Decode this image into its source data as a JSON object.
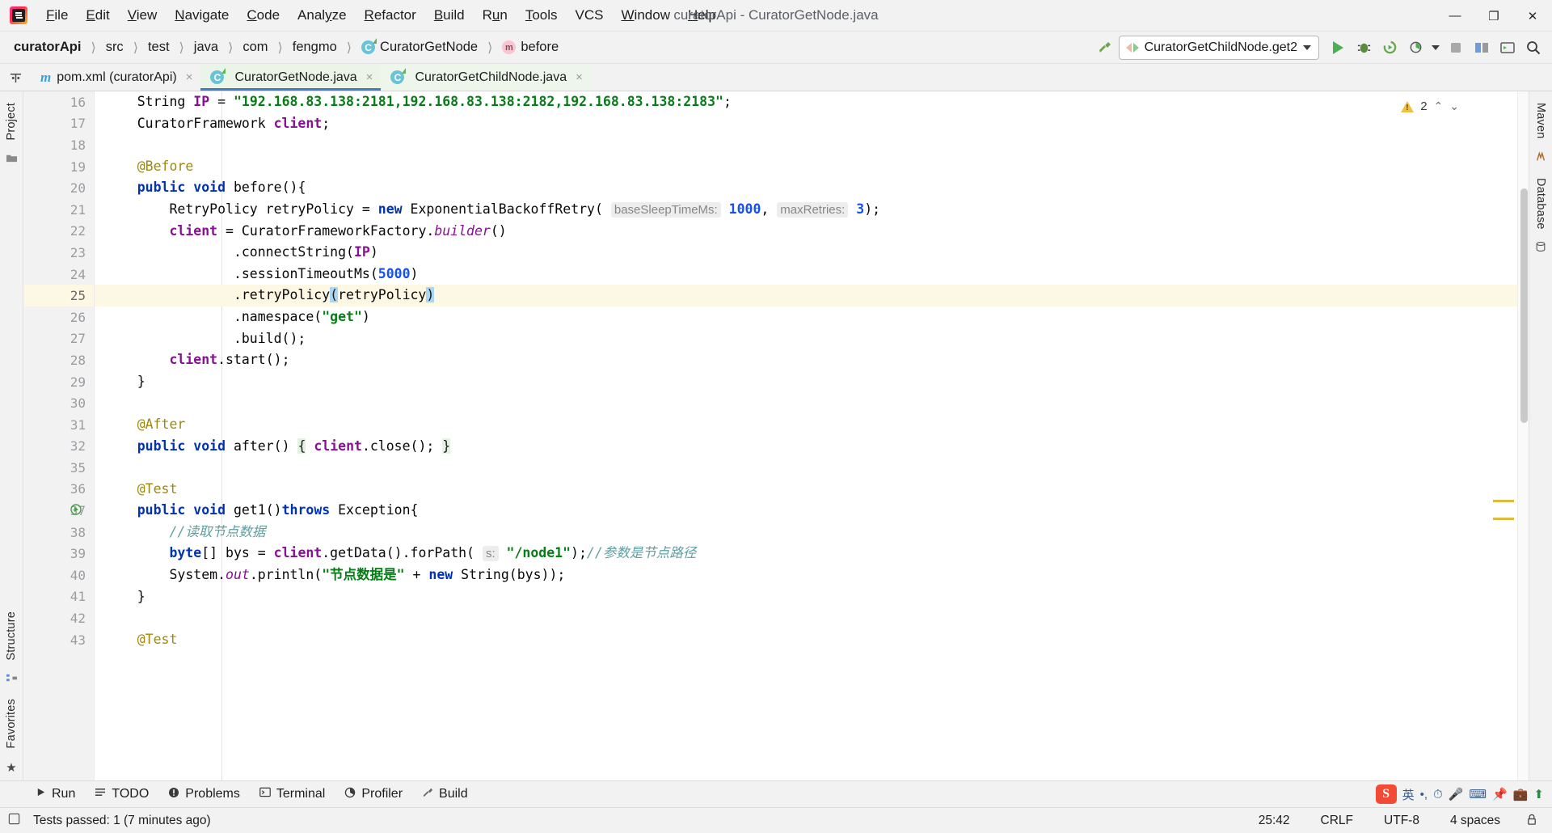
{
  "window": {
    "title": "curatorApi - CuratorGetNode.java",
    "logo_icon": "intellij-idea-logo",
    "minimize_label": "—",
    "maximize_label": "❐",
    "close_label": "✕"
  },
  "menu": [
    {
      "label": "File",
      "mnemonic": "F"
    },
    {
      "label": "Edit",
      "mnemonic": "E"
    },
    {
      "label": "View",
      "mnemonic": "V"
    },
    {
      "label": "Navigate",
      "mnemonic": "N"
    },
    {
      "label": "Code",
      "mnemonic": "C"
    },
    {
      "label": "Analyze",
      "mnemonic": "y"
    },
    {
      "label": "Refactor",
      "mnemonic": "R"
    },
    {
      "label": "Build",
      "mnemonic": "B"
    },
    {
      "label": "Run",
      "mnemonic": "u"
    },
    {
      "label": "Tools",
      "mnemonic": "T"
    },
    {
      "label": "VCS",
      "mnemonic": ""
    },
    {
      "label": "Window",
      "mnemonic": "W"
    },
    {
      "label": "Help",
      "mnemonic": "H"
    }
  ],
  "breadcrumb": [
    {
      "label": "curatorApi",
      "icon": "",
      "bold": true
    },
    {
      "label": "src",
      "icon": "",
      "bold": false
    },
    {
      "label": "test",
      "icon": "",
      "bold": false
    },
    {
      "label": "java",
      "icon": "",
      "bold": false
    },
    {
      "label": "com",
      "icon": "",
      "bold": false
    },
    {
      "label": "fengmo",
      "icon": "",
      "bold": false
    },
    {
      "label": "CuratorGetNode",
      "icon": "class-icon",
      "bold": false
    },
    {
      "label": "before",
      "icon": "method-icon",
      "bold": false
    }
  ],
  "navbar_right": {
    "build_icon": "hammer-icon",
    "run_config": "CuratorGetChildNode.get2",
    "run_config_icon": "run-config-icon",
    "dropdown_icon": "chevron-down-icon",
    "buttons": [
      {
        "name": "run-button",
        "glyph": "▶"
      },
      {
        "name": "debug-button",
        "glyph": "🐞"
      },
      {
        "name": "run-with-coverage-button",
        "glyph": "▶"
      },
      {
        "name": "profile-button",
        "glyph": "◴"
      },
      {
        "name": "profile-dropdown-icon",
        "glyph": "▾"
      },
      {
        "name": "stop-button",
        "glyph": "■"
      },
      {
        "name": "update-project-button",
        "glyph": "☰"
      },
      {
        "name": "open-in-browser-button",
        "glyph": "⬚"
      },
      {
        "name": "search-everywhere-button",
        "glyph": "🔍"
      }
    ]
  },
  "tabs": [
    {
      "label": "pom.xml (curatorApi)",
      "icon": "xml-file-icon",
      "active": false,
      "close": "×"
    },
    {
      "label": "CuratorGetNode.java",
      "icon": "java-class-icon",
      "active": true,
      "close": "×"
    },
    {
      "label": "CuratorGetChildNode.java",
      "icon": "java-class-icon",
      "active": false,
      "close": "×"
    }
  ],
  "left_stripe": [
    {
      "label": "Project",
      "name": "tool-window-project"
    },
    {
      "label": "Structure",
      "name": "tool-window-structure"
    },
    {
      "label": "Favorites",
      "name": "tool-window-favorites"
    }
  ],
  "right_stripe": [
    {
      "label": "Maven",
      "name": "tool-window-maven"
    },
    {
      "label": "Database",
      "name": "tool-window-database"
    }
  ],
  "editor": {
    "inspection_warnings": "2",
    "warning_icon": "warning-triangle-icon",
    "prev_icon": "⌃",
    "next_icon": "⌄",
    "lines": [
      {
        "n": "16",
        "tokens": [
          {
            "t": "    String ",
            "c": "plain"
          },
          {
            "t": "IP ",
            "c": "fld"
          },
          {
            "t": "= ",
            "c": "plain"
          },
          {
            "t": "\"192.168.83.138:2181,192.168.83.138:2182,192.168.83.138:2183\"",
            "c": "str"
          },
          {
            "t": ";",
            "c": "plain"
          }
        ]
      },
      {
        "n": "17",
        "tokens": [
          {
            "t": "    CuratorFramework ",
            "c": "plain"
          },
          {
            "t": "client",
            "c": "fld"
          },
          {
            "t": ";",
            "c": "plain"
          }
        ]
      },
      {
        "n": "18",
        "tokens": []
      },
      {
        "n": "19",
        "tokens": [
          {
            "t": "    @Before",
            "c": "ann"
          }
        ]
      },
      {
        "n": "20",
        "fold": true,
        "tokens": [
          {
            "t": "    ",
            "c": "plain"
          },
          {
            "t": "public void ",
            "c": "kw"
          },
          {
            "t": "before(){",
            "c": "plain"
          }
        ]
      },
      {
        "n": "21",
        "tokens": [
          {
            "t": "        RetryPolicy retryPolicy = ",
            "c": "plain"
          },
          {
            "t": "new ",
            "c": "kw"
          },
          {
            "t": "ExponentialBackoffRetry( ",
            "c": "plain"
          },
          {
            "t": "baseSleepTimeMs:",
            "c": "hint"
          },
          {
            "t": " ",
            "c": "plain"
          },
          {
            "t": "1000",
            "c": "num"
          },
          {
            "t": ", ",
            "c": "plain"
          },
          {
            "t": "maxRetries:",
            "c": "hint"
          },
          {
            "t": " ",
            "c": "plain"
          },
          {
            "t": "3",
            "c": "num"
          },
          {
            "t": ");",
            "c": "plain"
          }
        ]
      },
      {
        "n": "22",
        "tokens": [
          {
            "t": "        ",
            "c": "plain"
          },
          {
            "t": "client ",
            "c": "fld"
          },
          {
            "t": "= CuratorFrameworkFactory.",
            "c": "plain"
          },
          {
            "t": "builder",
            "c": "stat"
          },
          {
            "t": "()",
            "c": "plain"
          }
        ]
      },
      {
        "n": "23",
        "tokens": [
          {
            "t": "                .connectString(",
            "c": "plain"
          },
          {
            "t": "IP",
            "c": "fld"
          },
          {
            "t": ")",
            "c": "plain"
          }
        ]
      },
      {
        "n": "24",
        "tokens": [
          {
            "t": "                .sessionTimeoutMs(",
            "c": "plain"
          },
          {
            "t": "5000",
            "c": "num"
          },
          {
            "t": ")",
            "c": "plain"
          }
        ]
      },
      {
        "n": "25",
        "cur": true,
        "tokens": [
          {
            "t": "                .retryPolicy",
            "c": "plain"
          },
          {
            "t": "(",
            "c": "brkt-hl"
          },
          {
            "t": "retryPolicy",
            "c": "plain"
          },
          {
            "t": ")",
            "c": "brkt-hl"
          }
        ]
      },
      {
        "n": "26",
        "tokens": [
          {
            "t": "                .namespace(",
            "c": "plain"
          },
          {
            "t": "\"get\"",
            "c": "str"
          },
          {
            "t": ")",
            "c": "plain"
          }
        ]
      },
      {
        "n": "27",
        "tokens": [
          {
            "t": "                .build();",
            "c": "plain"
          }
        ]
      },
      {
        "n": "28",
        "tokens": [
          {
            "t": "        ",
            "c": "plain"
          },
          {
            "t": "client",
            "c": "fld"
          },
          {
            "t": ".start();",
            "c": "plain"
          }
        ]
      },
      {
        "n": "29",
        "fold": true,
        "tokens": [
          {
            "t": "    }",
            "c": "plain"
          }
        ]
      },
      {
        "n": "30",
        "tokens": []
      },
      {
        "n": "31",
        "tokens": [
          {
            "t": "    @After",
            "c": "ann"
          }
        ]
      },
      {
        "n": "32",
        "fold": true,
        "tokens": [
          {
            "t": "    ",
            "c": "plain"
          },
          {
            "t": "public void ",
            "c": "kw"
          },
          {
            "t": "after() ",
            "c": "plain"
          },
          {
            "t": "{",
            "c": "brace-hl"
          },
          {
            "t": " ",
            "c": "plain"
          },
          {
            "t": "client",
            "c": "fld"
          },
          {
            "t": ".close(); ",
            "c": "plain"
          },
          {
            "t": "}",
            "c": "brace-hl"
          }
        ]
      },
      {
        "n": "35",
        "tokens": []
      },
      {
        "n": "36",
        "tokens": [
          {
            "t": "    @Test",
            "c": "ann"
          }
        ]
      },
      {
        "n": "37",
        "fold": true,
        "runmark": true,
        "tokens": [
          {
            "t": "    ",
            "c": "plain"
          },
          {
            "t": "public void ",
            "c": "kw"
          },
          {
            "t": "get1()",
            "c": "plain"
          },
          {
            "t": "throws ",
            "c": "kw"
          },
          {
            "t": "Exception{",
            "c": "plain"
          }
        ]
      },
      {
        "n": "38",
        "tokens": [
          {
            "t": "        //读取节点数据",
            "c": "cmt-zh"
          }
        ]
      },
      {
        "n": "39",
        "tokens": [
          {
            "t": "        ",
            "c": "plain"
          },
          {
            "t": "byte",
            "c": "kw"
          },
          {
            "t": "[] bys = ",
            "c": "plain"
          },
          {
            "t": "client",
            "c": "fld"
          },
          {
            "t": ".getData().forPath( ",
            "c": "plain"
          },
          {
            "t": "s:",
            "c": "hint"
          },
          {
            "t": " ",
            "c": "plain"
          },
          {
            "t": "\"/node1\"",
            "c": "str"
          },
          {
            "t": ");",
            "c": "plain"
          },
          {
            "t": "//参数是节点路径",
            "c": "cmt-zh"
          }
        ]
      },
      {
        "n": "40",
        "tokens": [
          {
            "t": "        System.",
            "c": "plain"
          },
          {
            "t": "out",
            "c": "stat"
          },
          {
            "t": ".println(",
            "c": "plain"
          },
          {
            "t": "\"节点数据是\"",
            "c": "str"
          },
          {
            "t": " + ",
            "c": "plain"
          },
          {
            "t": "new ",
            "c": "kw"
          },
          {
            "t": "String(bys));",
            "c": "plain"
          }
        ]
      },
      {
        "n": "41",
        "fold": true,
        "tokens": [
          {
            "t": "    }",
            "c": "plain"
          }
        ]
      },
      {
        "n": "42",
        "tokens": []
      },
      {
        "n": "43",
        "tokens": [
          {
            "t": "    @Test",
            "c": "ann"
          }
        ]
      }
    ]
  },
  "bottom_toolwindows": [
    {
      "label": "Run",
      "icon": "run-icon",
      "name": "tool-window-run"
    },
    {
      "label": "TODO",
      "icon": "todo-icon",
      "name": "tool-window-todo"
    },
    {
      "label": "Problems",
      "icon": "problems-icon",
      "name": "tool-window-problems"
    },
    {
      "label": "Terminal",
      "icon": "terminal-icon",
      "name": "tool-window-terminal"
    },
    {
      "label": "Profiler",
      "icon": "profiler-icon",
      "name": "tool-window-profiler"
    },
    {
      "label": "Build",
      "icon": "build-icon",
      "name": "tool-window-build"
    }
  ],
  "tray": {
    "ime_label": "英",
    "items": [
      "sogou-icon",
      "ime-mode",
      "dot-menu",
      "clock-icon",
      "mic-icon",
      "keyboard-icon",
      "pin-icon",
      "toolbox-icon",
      "arrow-up-icon"
    ]
  },
  "statusbar": {
    "message": "Tests passed: 1 (7 minutes ago)",
    "message_icon": "tests-passed-icon",
    "caret": "25:42",
    "line_separator": "CRLF",
    "encoding": "UTF-8",
    "indent": "4 spaces",
    "lock_icon": "lock-icon"
  },
  "colors": {
    "accent": "#3d7fc1",
    "active_tab_bg": "#eaf5e8",
    "current_line_bg": "#fdf8e3",
    "string": "#067d17",
    "keyword": "#0033b3",
    "number": "#1750eb",
    "annotation": "#9e880d",
    "field": "#871094",
    "chinese_comment": "#5f9ea0",
    "warning": "#f0c040"
  }
}
